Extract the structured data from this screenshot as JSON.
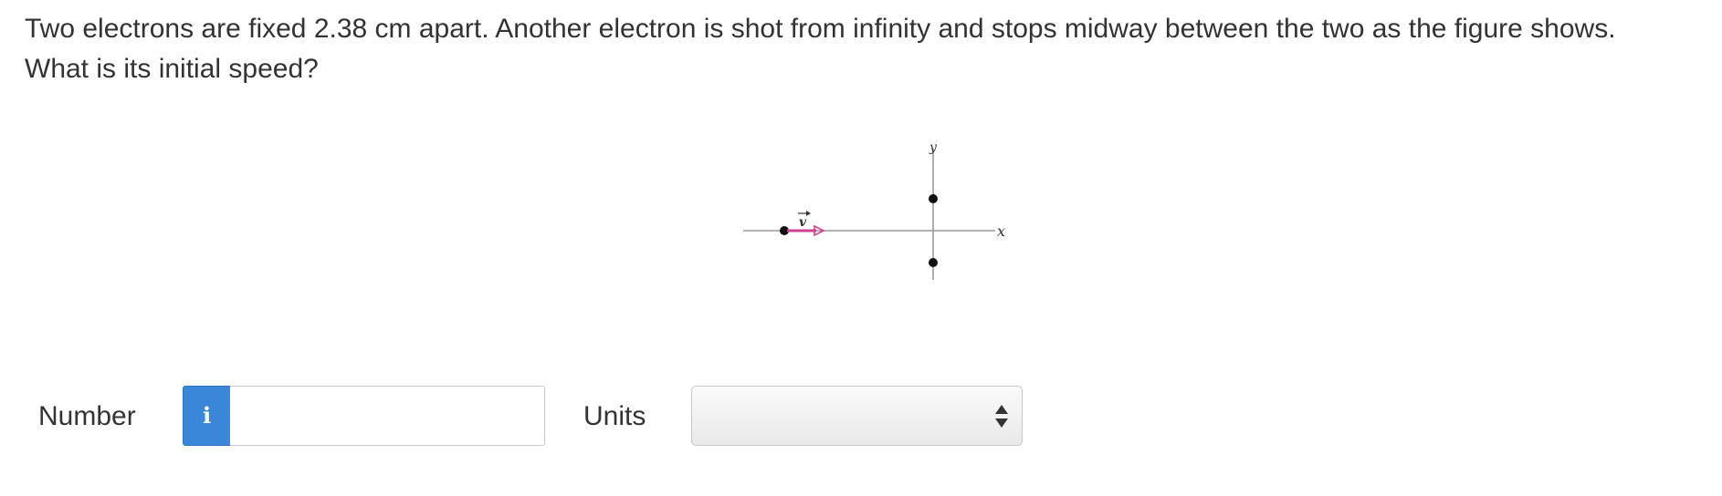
{
  "question": {
    "line1": "Two electrons are fixed 2.38 cm apart. Another electron is shot from infinity and stops midway between the two as the figure shows.",
    "line2": "What is its initial speed?"
  },
  "figure": {
    "axis_x_label": "x",
    "axis_y_label": "y",
    "velocity_label": "v",
    "arrow_color": "#d0408c",
    "point_color": "#111111",
    "axis_color": "#9a9a9a"
  },
  "answer": {
    "number_label": "Number",
    "number_value": "",
    "info_icon": "i",
    "units_label": "Units",
    "units_selected": ""
  },
  "colors": {
    "info_button": "#3a87d9",
    "text": "#333333"
  }
}
